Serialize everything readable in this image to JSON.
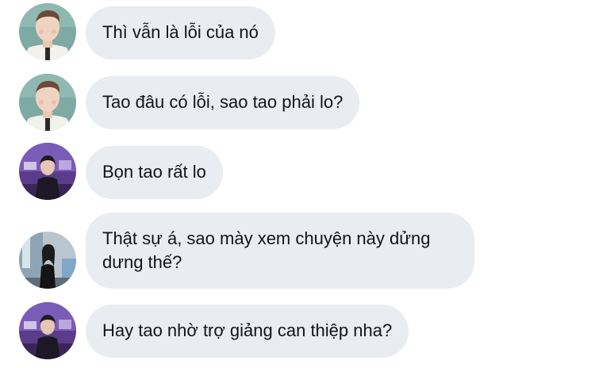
{
  "messages": [
    {
      "sender": "boy",
      "text": "Thì vẫn là lỗi của nó"
    },
    {
      "sender": "boy",
      "text": "Tao đâu có lỗi, sao tao phải lo?"
    },
    {
      "sender": "purple",
      "text": "Bọn tao rất lo"
    },
    {
      "sender": "girl",
      "text": "Thật sự á, sao mày xem chuyện này dửng dưng thế?"
    },
    {
      "sender": "purple",
      "text": "Hay tao nhờ trợ giảng can thiệp nha?"
    }
  ],
  "colors": {
    "bubble": "#e9ecf0",
    "text": "#111418",
    "background": "#ffffff"
  }
}
